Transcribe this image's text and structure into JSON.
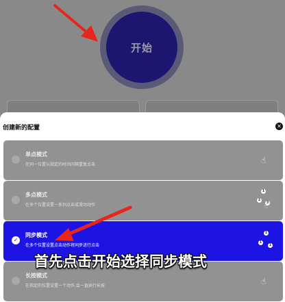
{
  "start": {
    "label": "开始"
  },
  "sheet": {
    "title": "创建新的配置",
    "close_icon": "close-icon"
  },
  "modes": [
    {
      "title": "单点模式",
      "desc": "在同一位置以指定的时间间隔重复点击",
      "icon": "single-tap-icon",
      "selected": false
    },
    {
      "title": "多点模式",
      "desc": "在多个位置设置一系列点击或滑动动作",
      "icon": "multi-tap-icon",
      "selected": false
    },
    {
      "title": "同步模式",
      "desc": "在多个位置设置点击动作将同步进行点击",
      "icon": "sync-tap-icon",
      "selected": true
    },
    {
      "title": "长按模式",
      "desc": "在指定的位置设置一个动作,会一直执行长按",
      "icon": "long-press-icon",
      "selected": false
    }
  ],
  "caption": "首先点击开始选择同步模式",
  "colors": {
    "accent": "#1d14e4",
    "arrow": "#e8241c",
    "start_button": "#1c1670"
  }
}
